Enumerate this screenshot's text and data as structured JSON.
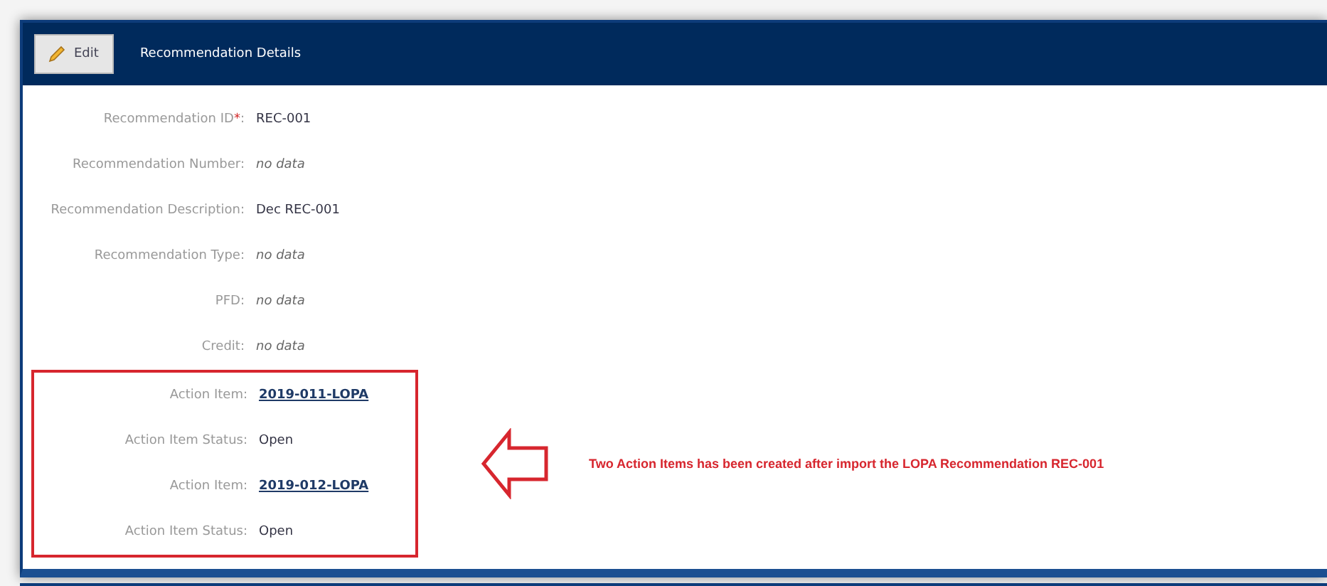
{
  "header": {
    "edit_button": "Edit",
    "title": "Recommendation Details"
  },
  "fields": [
    {
      "label": "Recommendation ID",
      "required": true,
      "value": "REC-001",
      "kind": "text"
    },
    {
      "label": "Recommendation Number:",
      "required": false,
      "value": "no data",
      "kind": "empty"
    },
    {
      "label": "Recommendation Description:",
      "required": false,
      "value": "Dec REC-001",
      "kind": "text"
    },
    {
      "label": "Recommendation Type:",
      "required": false,
      "value": "no data",
      "kind": "empty"
    },
    {
      "label": "PFD:",
      "required": false,
      "value": "no data",
      "kind": "empty"
    },
    {
      "label": "Credit:",
      "required": false,
      "value": "no data",
      "kind": "empty"
    }
  ],
  "highlighted_fields": [
    {
      "label": "Action Item:",
      "required": false,
      "value": "2019-011-LOPA",
      "kind": "link"
    },
    {
      "label": "Action Item Status:",
      "required": false,
      "value": "Open",
      "kind": "text"
    },
    {
      "label": "Action Item:",
      "required": false,
      "value": "2019-012-LOPA",
      "kind": "link"
    },
    {
      "label": "Action Item Status:",
      "required": false,
      "value": "Open",
      "kind": "text"
    }
  ],
  "annotation": "Two Action Items has been created after import the LOPA Recommendation REC-001",
  "required_mark": "*",
  "required_suffix": ":"
}
